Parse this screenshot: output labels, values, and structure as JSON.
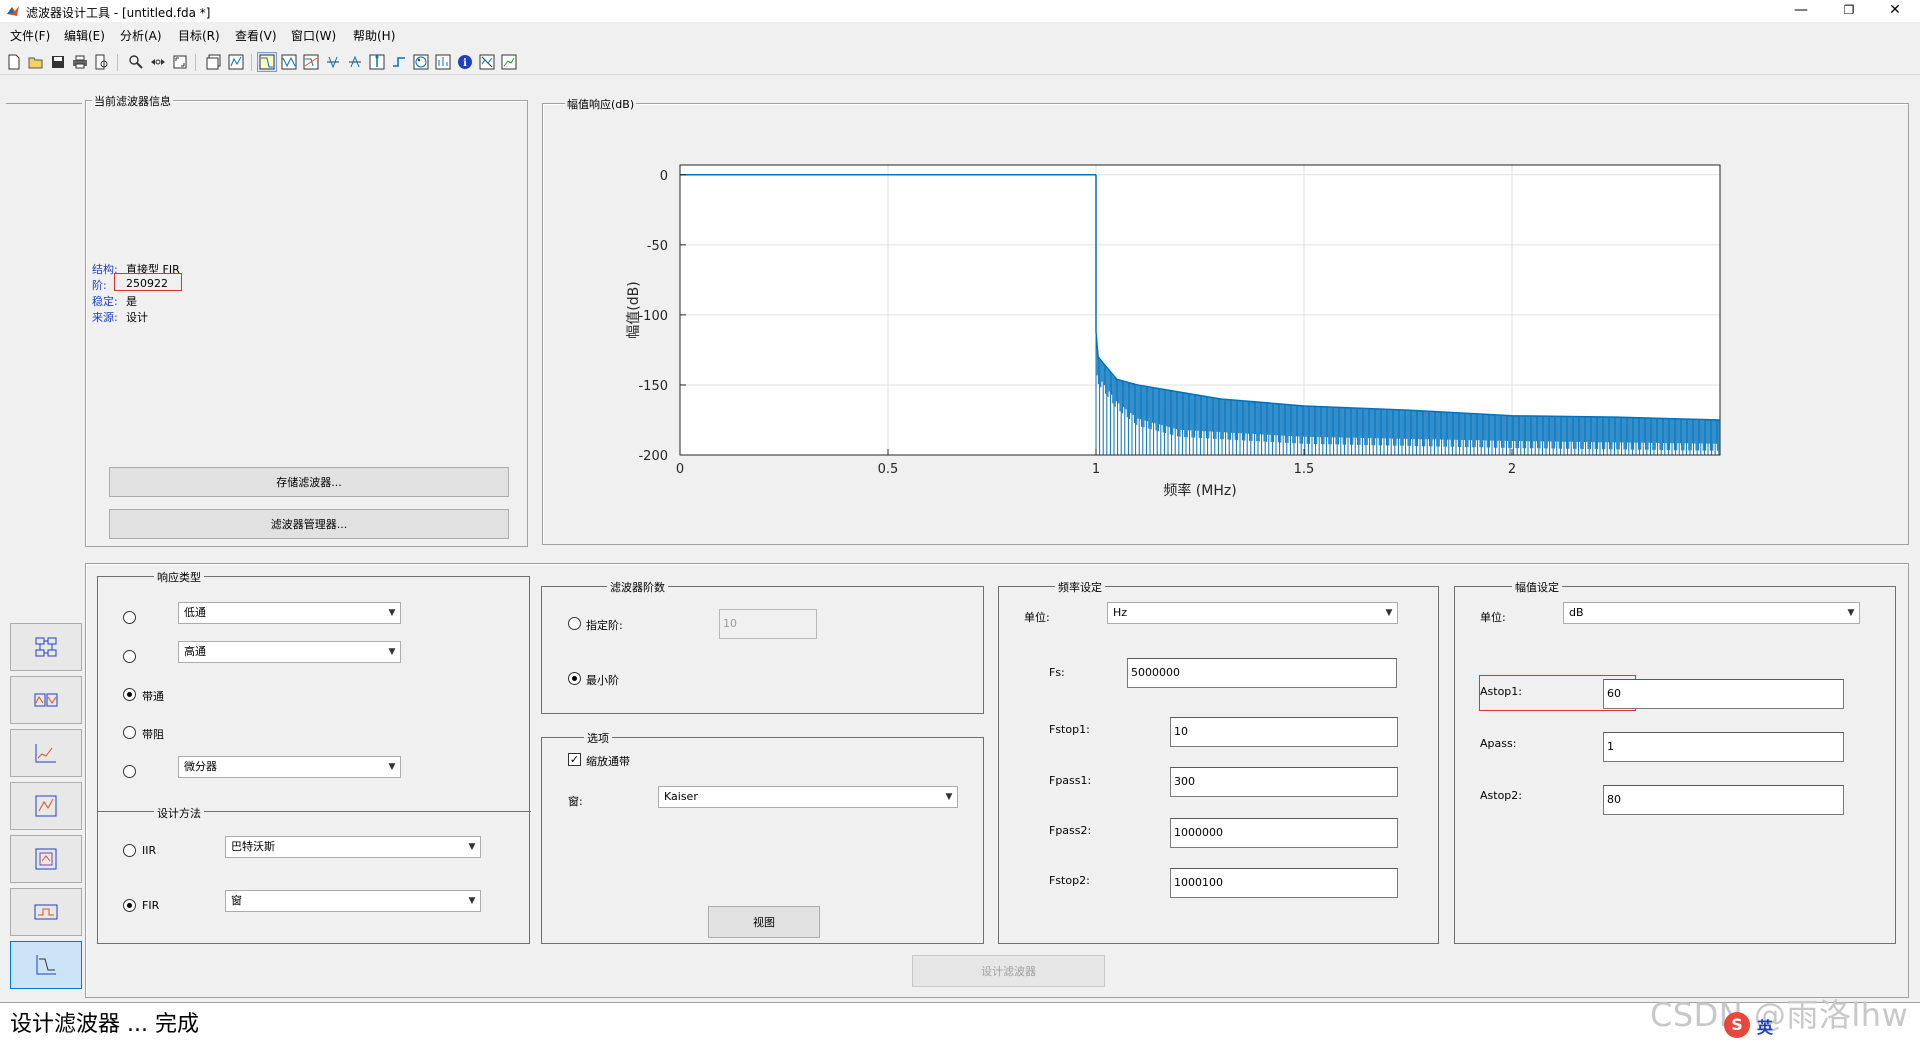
{
  "window": {
    "title": "滤波器设计工具 -  [untitled.fda *]",
    "controls": {
      "minimize": "—",
      "restore": "❐",
      "close": "✕"
    }
  },
  "menu": [
    "文件(F)",
    "编辑(E)",
    "分析(A)",
    "目标(R)",
    "查看(V)",
    "窗口(W)",
    "帮助(H)"
  ],
  "toolbar": {
    "icons": [
      "new-icon",
      "open-icon",
      "save-icon",
      "print-icon",
      "print-preview-icon",
      "zoom-in-icon",
      "zoom-x-icon",
      "full-view-icon",
      "new-window-icon",
      "full-view-analysis-icon",
      "magnitude-response-icon",
      "phase-response-icon",
      "mag-phase-icon",
      "group-delay-icon",
      "phase-delay-icon",
      "impulse-response-icon",
      "step-response-icon",
      "pole-zero-icon",
      "coefficients-icon",
      "info-icon",
      "noise-icon",
      "round-off-icon"
    ]
  },
  "filter_info": {
    "title": "当前滤波器信息",
    "labels": {
      "structure": "结构:",
      "order": "阶:",
      "stable": "稳定:",
      "source": "来源:"
    },
    "values": {
      "structure": "直接型 FIR",
      "order": "250922",
      "stable": "是",
      "source": "设计"
    },
    "store_button": "存储滤波器...",
    "manager_button": "滤波器管理器..."
  },
  "magnitude_panel": {
    "title": "幅值响应(dB)"
  },
  "chart_data": {
    "type": "line",
    "title": "",
    "xlabel": "频率 (MHz)",
    "ylabel": "幅值(dB)",
    "xlim": [
      0,
      2.5
    ],
    "ylim": [
      -200,
      7
    ],
    "x_ticks": [
      0,
      0.5,
      1,
      1.5,
      2
    ],
    "y_ticks": [
      0,
      -50,
      -100,
      -150,
      -200
    ],
    "x_tick_labels": [
      "0",
      "0.5",
      "1",
      "1.5",
      "2"
    ],
    "y_tick_labels": [
      "0",
      "-50",
      "-100",
      "-150",
      "-200"
    ],
    "grid": true,
    "color": "#0072bd",
    "series": [
      {
        "passband": {
          "x": [
            0,
            1.0
          ],
          "y": [
            0,
            0
          ]
        },
        "stopband_upper": {
          "x": [
            1.0,
            1.005,
            1.05,
            1.1,
            1.2,
            1.3,
            1.5,
            1.75,
            2.0,
            2.25,
            2.5
          ],
          "y": [
            -112,
            -130,
            -146,
            -150,
            -155,
            -160,
            -165,
            -168,
            -172,
            -173,
            -175
          ]
        },
        "stopband_lower": {
          "x": [
            1.0,
            1.05,
            1.1,
            1.2,
            1.5,
            2.0,
            2.5
          ],
          "y": [
            -150,
            -170,
            -182,
            -190,
            -195,
            -198,
            -200
          ]
        }
      }
    ]
  },
  "response_type": {
    "title": "响应类型",
    "options": [
      {
        "label": "",
        "combo": "低通",
        "checked": false
      },
      {
        "label": "",
        "combo": "高通",
        "checked": false
      },
      {
        "label": "带通",
        "combo": "",
        "checked": true
      },
      {
        "label": "带阻",
        "combo": "",
        "checked": false
      },
      {
        "label": "",
        "combo": "微分器",
        "checked": false
      }
    ]
  },
  "design_method": {
    "title": "设计方法",
    "iir_label": "IIR",
    "iir_combo": "巴特沃斯",
    "fir_label": "FIR",
    "fir_combo": "窗",
    "selected": "FIR"
  },
  "filter_order": {
    "title": "滤波器阶数",
    "specify_label": "指定阶:",
    "specify_value": "10",
    "minimum_label": "最小阶",
    "selected": "minimum"
  },
  "options": {
    "title": "选项",
    "scale_passband_label": "缩放通带",
    "scale_passband_checked": true,
    "window_label": "窗:",
    "window_value": "Kaiser",
    "view_button": "视图"
  },
  "freq_spec": {
    "title": "频率设定",
    "unit_label": "单位:",
    "unit_value": "Hz",
    "fs_label": "Fs:",
    "fs_value": "5000000",
    "fstop1_label": "Fstop1:",
    "fstop1_value": "10",
    "fpass1_label": "Fpass1:",
    "fpass1_value": "300",
    "fpass2_label": "Fpass2:",
    "fpass2_value": "1000000",
    "fstop2_label": "Fstop2:",
    "fstop2_value": "1000100"
  },
  "mag_spec": {
    "title": "幅值设定",
    "unit_label": "单位:",
    "unit_value": "dB",
    "astop1_label": "Astop1:",
    "astop1_value": "60",
    "apass_label": "Apass:",
    "apass_value": "1",
    "astop2_label": "Astop2:",
    "astop2_value": "80"
  },
  "design_button": "设计滤波器",
  "status": "设计滤波器 ... 完成",
  "watermark": "CSDN @雨洛lhw",
  "ime": "英"
}
